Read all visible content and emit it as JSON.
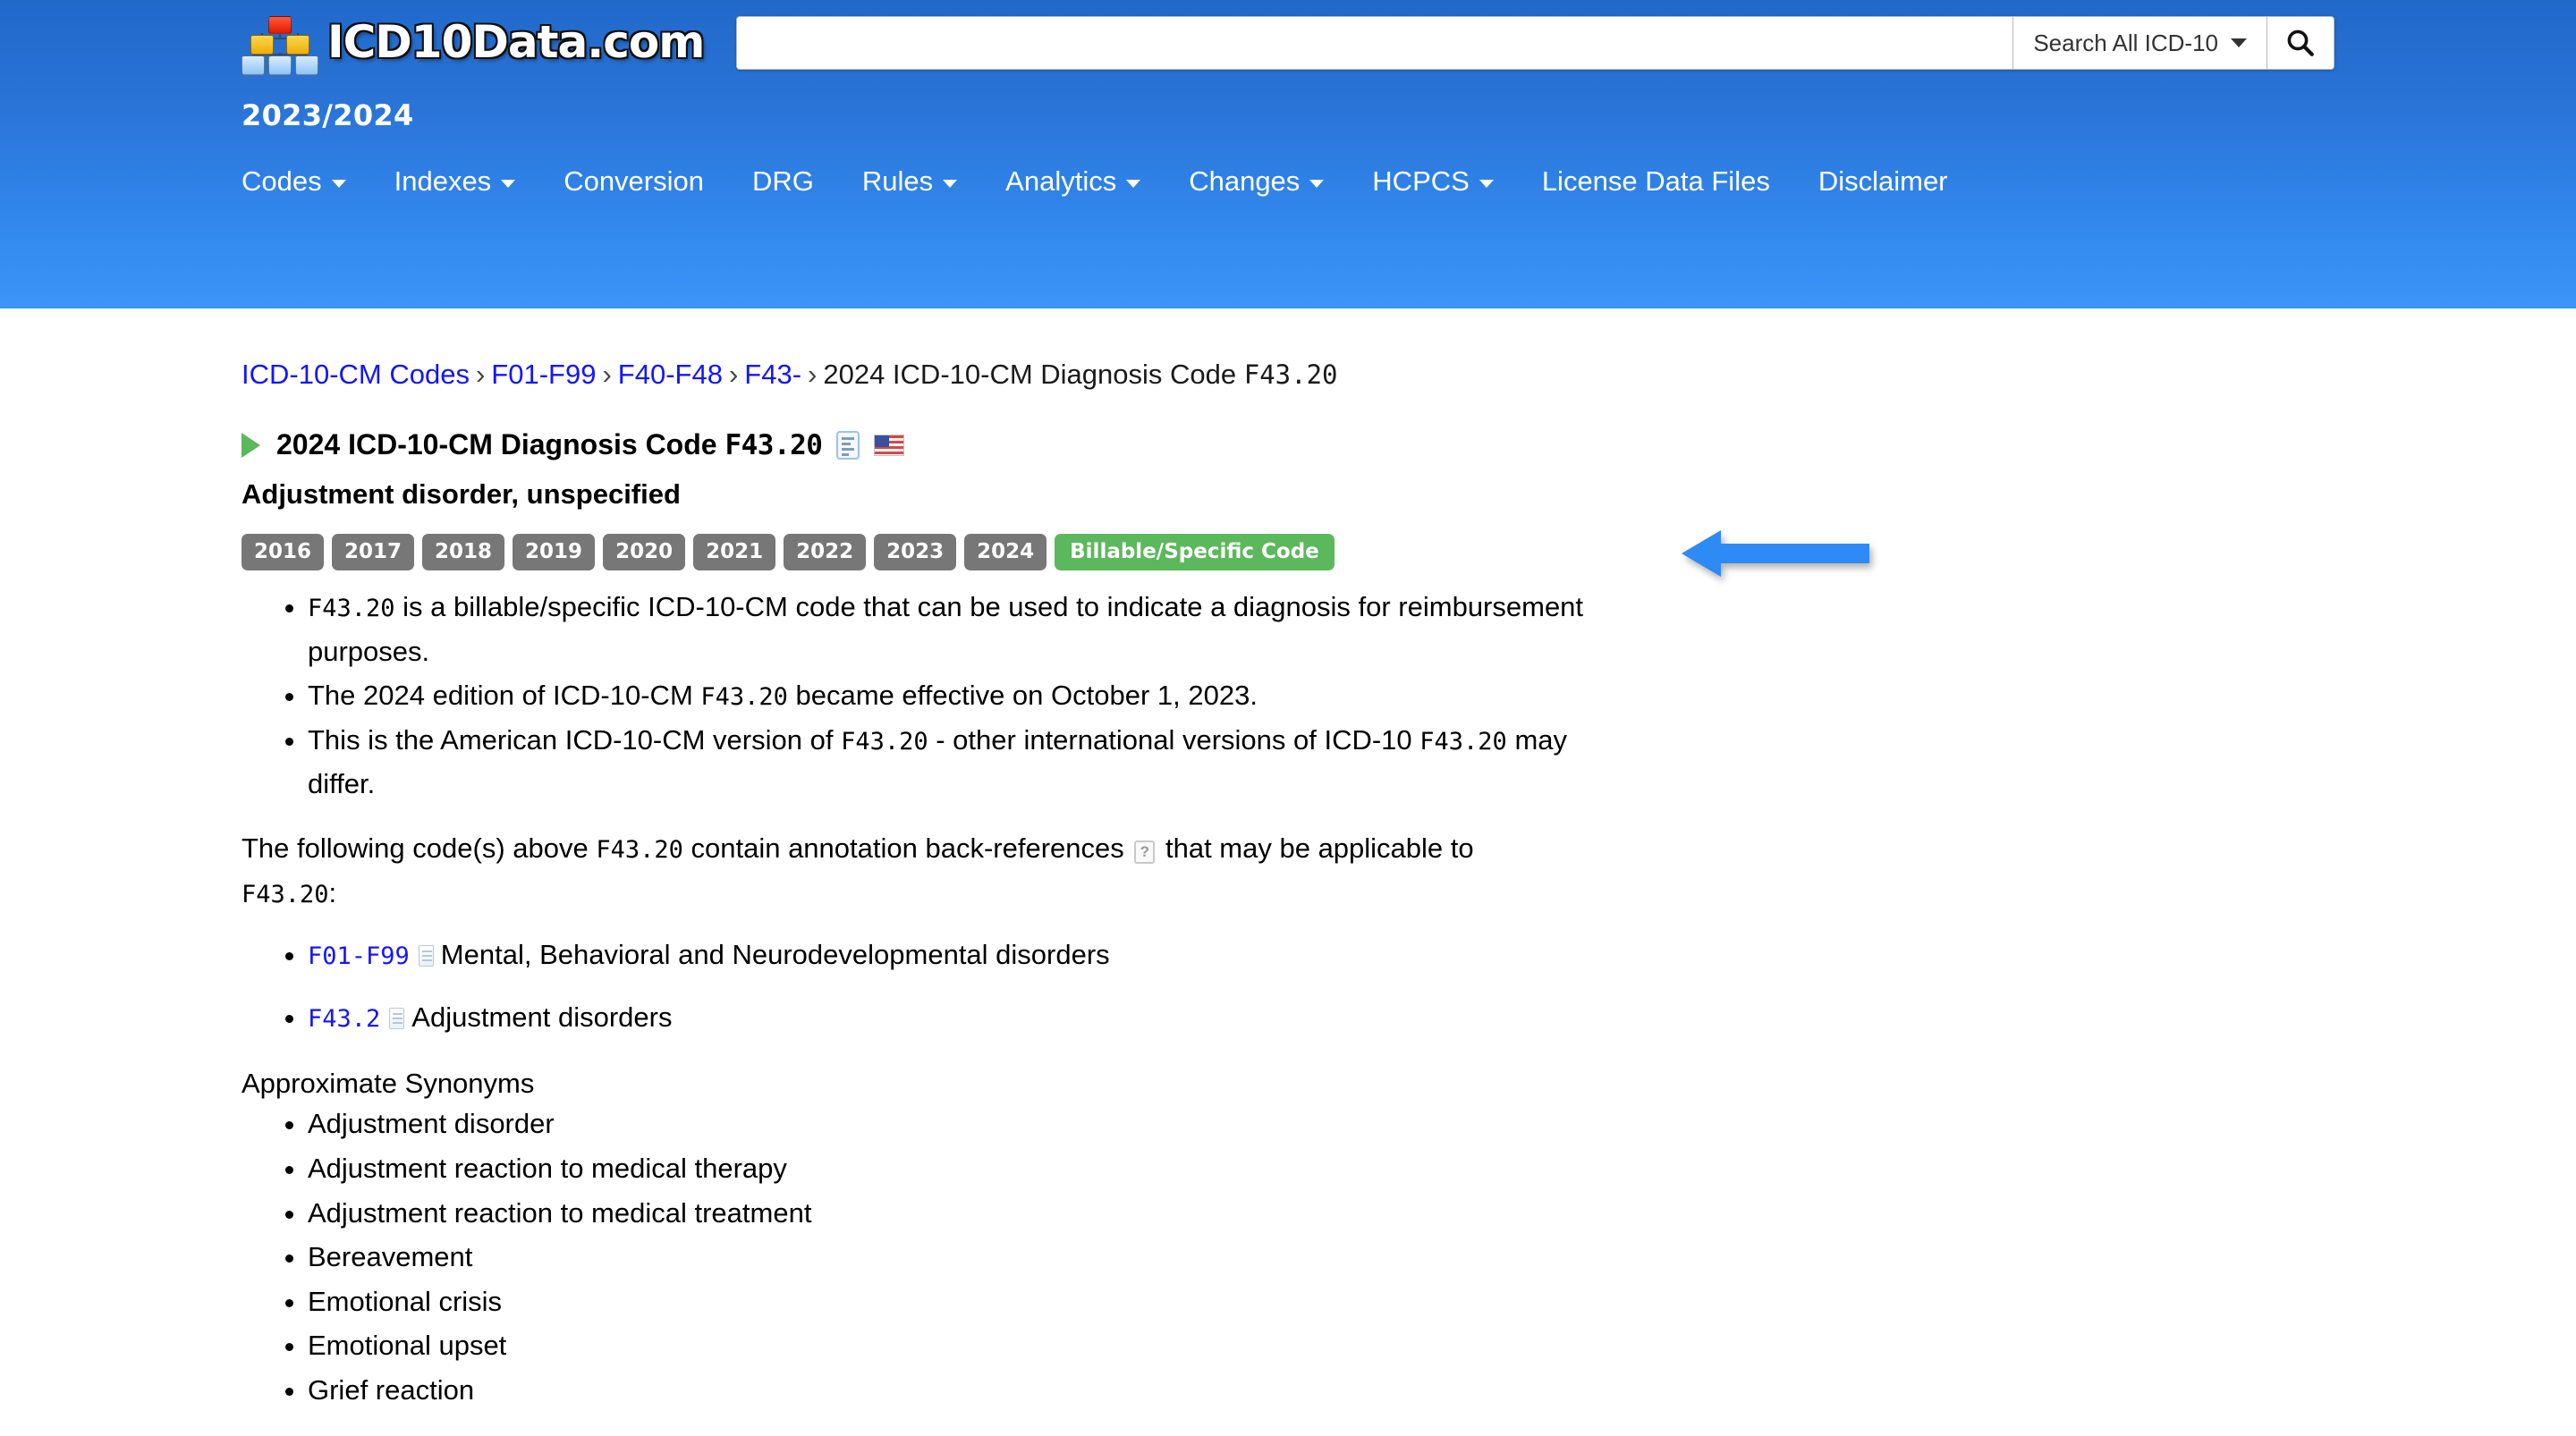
{
  "header": {
    "logo_text": "ICD10Data.com",
    "logo_icon": "hierarchy-tree-icon",
    "search": {
      "value": "",
      "placeholder": "",
      "scope_label": "Search All ICD-10",
      "search_icon": "magnifier-icon"
    },
    "edition_label": "2023/2024",
    "nav": [
      {
        "label": "Codes",
        "has_caret": true
      },
      {
        "label": "Indexes",
        "has_caret": true
      },
      {
        "label": "Conversion",
        "has_caret": false
      },
      {
        "label": "DRG",
        "has_caret": false
      },
      {
        "label": "Rules",
        "has_caret": true
      },
      {
        "label": "Analytics",
        "has_caret": true
      },
      {
        "label": "Changes",
        "has_caret": true
      },
      {
        "label": "HCPCS",
        "has_caret": true
      },
      {
        "label": "License Data Files",
        "has_caret": false
      },
      {
        "label": "Disclaimer",
        "has_caret": false
      }
    ]
  },
  "breadcrumb": {
    "links": [
      "ICD-10-CM Codes",
      "F01-F99",
      "F40-F48",
      "F43-"
    ],
    "separator": "›",
    "current_prefix": "2024 ICD-10-CM Diagnosis Code",
    "current_code": "F43.20"
  },
  "code_page": {
    "title_prefix": "2024 ICD-10-CM Diagnosis Code",
    "title_code": "F43.20",
    "note_icon": "clipboard-note-icon",
    "flag_icon": "us-flag-icon",
    "expand_icon": "green-triangle-icon",
    "subtitle": "Adjustment disorder, unspecified",
    "year_badges": [
      "2016",
      "2017",
      "2018",
      "2019",
      "2020",
      "2021",
      "2022",
      "2023",
      "2024"
    ],
    "billable_badge": "Billable/Specific Code",
    "billable_color": "#5cb85c",
    "year_badge_color": "#777777",
    "annotation_arrow": {
      "name": "blue-arrow-annotation",
      "color": "#2e8af5",
      "direction": "left"
    },
    "facts": [
      {
        "code": "F43.20",
        "text_after": " is a billable/specific ICD-10-CM code that can be used to indicate a diagnosis for reimbursement purposes."
      },
      {
        "text_before": "The 2024 edition of ICD-10-CM ",
        "code": "F43.20",
        "text_after": " became effective on October 1, 2023."
      },
      {
        "text_before": "This is the American ICD-10-CM version of ",
        "code": "F43.20",
        "text_mid": " - other international versions of ICD-10 ",
        "code2": "F43.20",
        "text_after": " may differ."
      }
    ],
    "backref_paragraph": {
      "part1": "The following code(s) above ",
      "code1": "F43.20",
      "part2": " contain annotation back-references ",
      "help_icon": "question-mark-icon",
      "part3": " that may be applicable to ",
      "code2": "F43.20",
      "part4": ":"
    },
    "back_references": [
      {
        "code": "F01-F99",
        "doc_icon": "document-icon",
        "label": "Mental, Behavioral and Neurodevelopmental disorders"
      },
      {
        "code": "F43.2",
        "doc_icon": "document-icon",
        "label": "Adjustment disorders"
      }
    ],
    "synonyms_heading": "Approximate Synonyms",
    "synonyms": [
      "Adjustment disorder",
      "Adjustment reaction to medical therapy",
      "Adjustment reaction to medical treatment",
      "Bereavement",
      "Emotional crisis",
      "Emotional upset",
      "Grief reaction"
    ]
  }
}
